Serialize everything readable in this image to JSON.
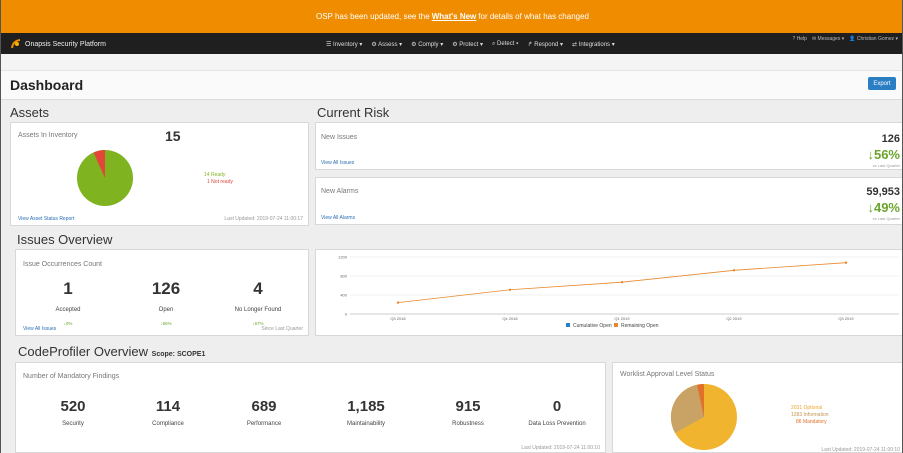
{
  "banner": {
    "pre": "OSP has been updated, see the",
    "link": "What's New",
    "post": "for details of what has changed"
  },
  "navbar": {
    "brand": "Onapsis Security Platform",
    "menu": [
      "Inventory",
      "Assess",
      "Comply",
      "Protect",
      "Detect",
      "Respond",
      "Integrations"
    ],
    "right": [
      "Help",
      "Messages",
      "Christian Gomez"
    ]
  },
  "page": {
    "title": "Dashboard",
    "export_label": "Export"
  },
  "assets": {
    "section": "Assets",
    "panel_title": "Assets In Inventory",
    "total": "15",
    "ready_count": "14",
    "ready_label": "Ready",
    "notready_count": "1",
    "notready_label": "Not ready",
    "ready_fraction": 0.933,
    "link": "View Asset Status Report",
    "updated": "Last Updated: 2019-07-24 11:00:17"
  },
  "risk": {
    "section": "Current Risk",
    "issues": {
      "label": "New Issues",
      "value": "126",
      "pct": "↓56%",
      "vs": "vs Last Quarter",
      "link": "View All Issues"
    },
    "alarms": {
      "label": "New Alarms",
      "value": "59,953",
      "pct": "↓49%",
      "vs": "vs Last Quarter",
      "link": "View All Alarms"
    }
  },
  "issues_overview": {
    "section": "Issues Overview",
    "panel_title": "Issue Occurrences Count",
    "stats": [
      {
        "value": "1",
        "label": "Accepted",
        "delta": "↓0%"
      },
      {
        "value": "126",
        "label": "Open",
        "delta": "↓56%"
      },
      {
        "value": "4",
        "label": "No Longer Found",
        "delta": "↓67%"
      }
    ],
    "link": "View All Issues",
    "since": "Since Last Quarter"
  },
  "chart_data": {
    "type": "line",
    "categories": [
      "Q3 2018",
      "Q4 2018",
      "Q1 2019",
      "Q2 2019",
      "Q3 2019"
    ],
    "series": [
      {
        "name": "Cumulative Open",
        "values": [
          null,
          null,
          null,
          null,
          null
        ]
      },
      {
        "name": "Remaining Open",
        "values": [
          240,
          510,
          670,
          920,
          1080
        ]
      }
    ],
    "yticks": [
      "0",
      "400",
      "800",
      "1200"
    ],
    "ylim": [
      0,
      1200
    ],
    "legend_position": "bottom",
    "colors": {
      "cumulative": "#2a7ec3",
      "remaining": "#e8882c"
    }
  },
  "codeprofiler": {
    "section": "CodeProfiler Overview",
    "scope": "Scope: SCOPE1",
    "panel_title": "Number of Mandatory Findings",
    "stats": [
      {
        "value": "520",
        "label": "Security"
      },
      {
        "value": "114",
        "label": "Compliance"
      },
      {
        "value": "689",
        "label": "Performance"
      },
      {
        "value": "1,185",
        "label": "Maintainability"
      },
      {
        "value": "915",
        "label": "Robustness"
      },
      {
        "value": "0",
        "label": "Data Loss Prevention"
      }
    ],
    "updated": "Last Updated: 2019-07-24 11:00:10"
  },
  "worklist": {
    "panel_title": "Worklist Approval Level Status",
    "items": [
      {
        "count": "2031",
        "label": "Optional"
      },
      {
        "count": "1283",
        "label": "Information"
      },
      {
        "count": "86",
        "label": "Mandatory"
      }
    ],
    "updated": "Last Updated: 2019-07-24 11:00:10"
  },
  "colors": {
    "banner": "#f08c00",
    "navbar": "#1f1f1f",
    "accent": "#2a7ec3",
    "green": "#7fb31f",
    "red": "#e2463a",
    "positive": "#6aa52a"
  }
}
